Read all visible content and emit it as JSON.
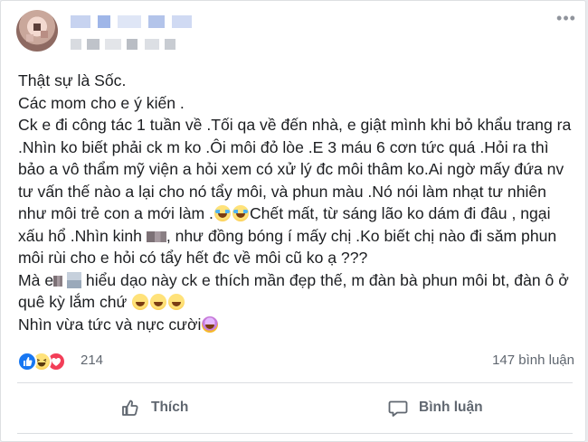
{
  "post": {
    "header": {
      "more_label": "•••"
    },
    "paragraphs": {
      "p1": "Thật sự là Sốc.",
      "p2": "Các mom cho e ý kiến .",
      "p3a": "Ck e đi công tác 1 tuần về .Tối qa về đến nhà, e giật mình khi bỏ khẩu trang ra .Nhìn ko biết phải ck m ko .Ôi môi đỏ lòe .E 3 máu 6 cơn tức quá .Hỏi ra thì bảo a vô thẩm mỹ viện a hỏi xem có xử lý đc môi thâm ko.Ai ngờ mấy đứa nv tư vấn thế nào a lại cho nó tẩy môi, và phun màu .Nó nói làm nhạt tư nhiên như môi trẻ con a mới làm .",
      "p3b": "Chết mất, từ sáng lão ko dám đi đâu , ngại xấu hổ .Nhìn kinh",
      "p3c": ", như đồng bóng í mấy chị .Ko biết chị nào đi săm phun môi rùi cho e hỏi có tẩy hết đc về môi cũ ko ạ ???",
      "p4a": "Mà e",
      "p4b": "hiểu dạo này ck e thích mần đẹp thế, m đàn bà phun môi bt, đàn ô ở quê kỳ lắm chứ",
      "p5": "Nhìn vừa tức và nực cười"
    },
    "emojis": [
      "rolling-on-floor-laughing",
      "rolling-on-floor-laughing",
      "grinning-squinting",
      "grinning-squinting",
      "grinning-squinting",
      "dizzy-face"
    ],
    "stats": {
      "reaction_count": "214",
      "comment_count": "147 bình luận"
    },
    "actions": {
      "like_label": "Thích",
      "comment_label": "Bình luận"
    }
  },
  "colors": {
    "like_blue": "#1877f2",
    "love_red": "#f33e58",
    "muted_text": "#606770"
  }
}
